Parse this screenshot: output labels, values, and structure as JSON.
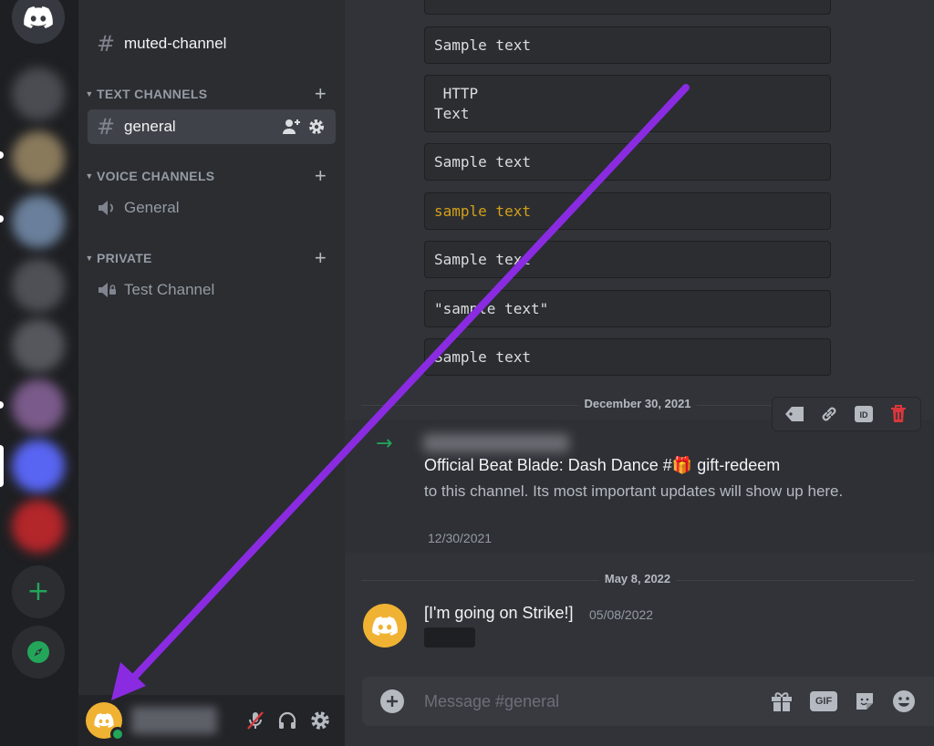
{
  "sidebar": {
    "top_channel": {
      "hash": "#",
      "label": "muted-channel"
    },
    "categories": [
      {
        "label": "TEXT CHANNELS",
        "chevron": "▼",
        "add": "+"
      },
      {
        "label": "VOICE CHANNELS",
        "chevron": "▼",
        "add": "+"
      },
      {
        "label": "PRIVATE",
        "chevron": "▼",
        "add": "+"
      }
    ],
    "channels": [
      {
        "hash": "#",
        "label": "general",
        "type": "text",
        "active": true
      },
      {
        "label": "General",
        "type": "voice",
        "icon": "speaker-icon"
      },
      {
        "label": "Test Channel",
        "type": "voice-locked",
        "icon": "locked-speaker-icon"
      }
    ],
    "user_panel": {
      "avatar_icon": "discord-logo-icon",
      "status": "online",
      "icons": [
        "muted-mic-icon",
        "headphones-icon",
        "gear-icon"
      ]
    }
  },
  "rail": {
    "home_icon": "discord-logo-icon",
    "add_server": "+",
    "explore_icon": "compass-icon"
  },
  "chat": {
    "code_blocks": [
      {
        "text": "Sample text"
      },
      {
        "text": " HTTP\nText"
      },
      {
        "text": "Sample text"
      },
      {
        "text": "sample text",
        "color": "#d4a017"
      },
      {
        "text": "Sample text"
      },
      {
        "text": "\"sample text\""
      },
      {
        "text": "Sample text"
      }
    ],
    "dividers": [
      "December 30, 2021",
      "May 8, 2022"
    ],
    "system_message": {
      "arrow": "→",
      "title": "Official Beat Blade: Dash Dance #🎁 gift-redeem",
      "body": " to this channel. Its most important updates will show up here.",
      "date": "12/30/2021"
    },
    "message_actions": [
      "tag-icon",
      "link-icon",
      "id-icon",
      "trash-icon"
    ],
    "message": {
      "author": "[I'm going on Strike!]",
      "timestamp": "05/08/2022"
    },
    "composer": {
      "placeholder": "Message #general",
      "tools": [
        "gift-icon",
        "gif-icon",
        "sticker-icon",
        "emoji-icon"
      ],
      "gif_label": "GIF"
    }
  },
  "colors": {
    "accent_arrow": "#8a2be2",
    "online": "#23a55a",
    "avatar_bg": "#f0b232",
    "danger": "#da373c"
  }
}
